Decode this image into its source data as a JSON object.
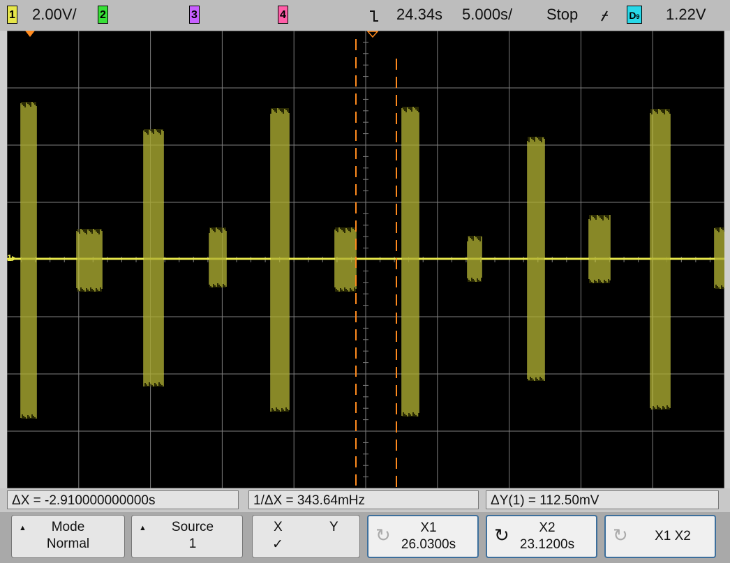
{
  "topbar": {
    "ch1": "1",
    "ch1_scale": "2.00V/",
    "ch2": "2",
    "ch3": "3",
    "ch4": "4",
    "delay": "24.34s",
    "timebase": "5.000s/",
    "run_state": "Stop",
    "trig_source": "D",
    "trig_level": "1.22V"
  },
  "screen": {
    "ground_label": "1"
  },
  "measurements": {
    "delta_x": "ΔX = -2.910000000000s",
    "inv_delta_x": "1/ΔX = 343.64mHz",
    "delta_y": "ΔY(1) = 112.50mV"
  },
  "softkeys": {
    "mode": {
      "label": "Mode",
      "value": "Normal"
    },
    "source": {
      "label": "Source",
      "value": "1"
    },
    "xy": {
      "x_label": "X",
      "y_label": "Y",
      "check": "✓"
    },
    "x1": {
      "label": "X1",
      "value": "26.0300s"
    },
    "x2": {
      "label": "X2",
      "value": "23.1200s"
    },
    "x1x2": {
      "label": "X1 X2"
    }
  },
  "colors": {
    "ch1": "#e6e64a",
    "ch2": "#38e038",
    "ch3": "#c860ff",
    "ch4": "#ff5ea8",
    "cursor": "#ff8a1e",
    "grid": "#7f7f7f",
    "screen_bg": "#000000"
  },
  "icons": {
    "trigger_edge": "falling-edge-icon",
    "trigger_slope": "rising-slope-icon",
    "cursor_arrow": "orange-triangle-marker"
  }
}
